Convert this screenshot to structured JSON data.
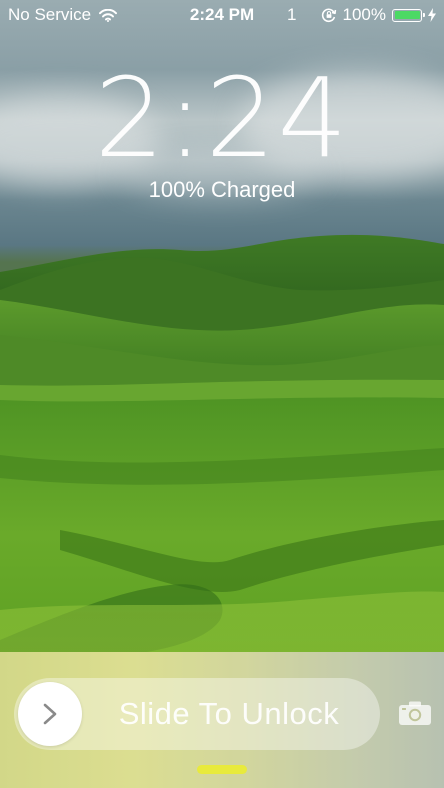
{
  "status_bar": {
    "carrier": "No Service",
    "wifi_icon": "wifi-icon",
    "time": "2:24 PM",
    "notification_count": "1",
    "lock_rotation_icon": "rotation-lock-icon",
    "battery_percent_text": "100%",
    "battery_level": 1.0,
    "battery_color": "#4cd964",
    "charging_icon": "lightning-bolt-icon"
  },
  "lock_screen": {
    "clock": "2:24",
    "charge_status": "100% Charged"
  },
  "unlock_slider": {
    "knob_icon": "chevron-right-icon",
    "label": "Slide To Unlock"
  },
  "camera_shortcut": {
    "icon": "camera-icon"
  },
  "control_center_grabber": {
    "color": "#e8ea3c"
  }
}
